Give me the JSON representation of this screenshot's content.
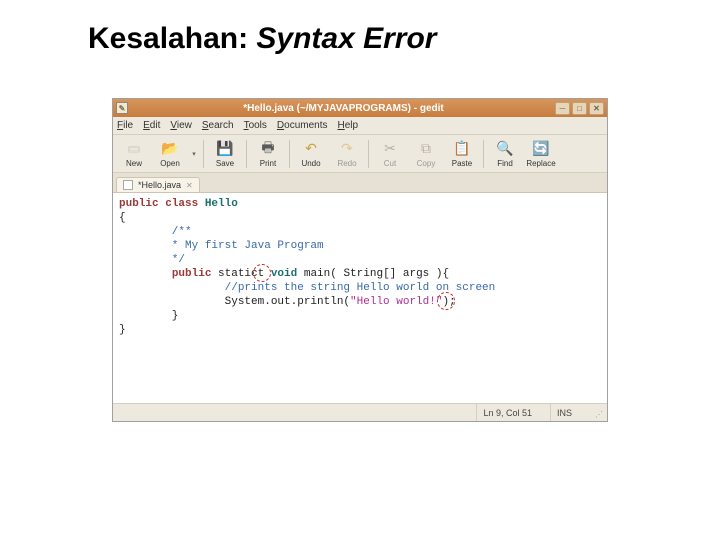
{
  "slide": {
    "title_a": "Kesalahan: ",
    "title_b": "Syntax Error"
  },
  "window": {
    "title": "*Hello.java (~/MYJAVAPROGRAMS) - gedit"
  },
  "menu": {
    "file": "File",
    "edit": "Edit",
    "view": "View",
    "search": "Search",
    "tools": "Tools",
    "documents": "Documents",
    "help": "Help"
  },
  "toolbar": {
    "new": "New",
    "open": "Open",
    "save": "Save",
    "print": "Print",
    "undo": "Undo",
    "redo": "Redo",
    "cut": "Cut",
    "copy": "Copy",
    "paste": "Paste",
    "find": "Find",
    "replace": "Replace"
  },
  "tab": {
    "label": "*Hello.java"
  },
  "code": {
    "l1_kw": "public class",
    "l1_cls": " Hello",
    "l2": "{",
    "l3": "        /**",
    "l4": "        * My first Java Program",
    "l5": "        */",
    "l6a": "        ",
    "l6_kw": "public",
    "l6b": " statict",
    "l6c": " void",
    "l6d": " main( String[] args ){",
    "l7": "                //prints the string Hello world on screen",
    "l8a": "                System.out.println(",
    "l8_str": "\"Hello world!\"",
    "l8b": ");",
    "l9": "        }",
    "l10": "}"
  },
  "status": {
    "pos": "Ln 9, Col 51",
    "ins": "INS"
  }
}
